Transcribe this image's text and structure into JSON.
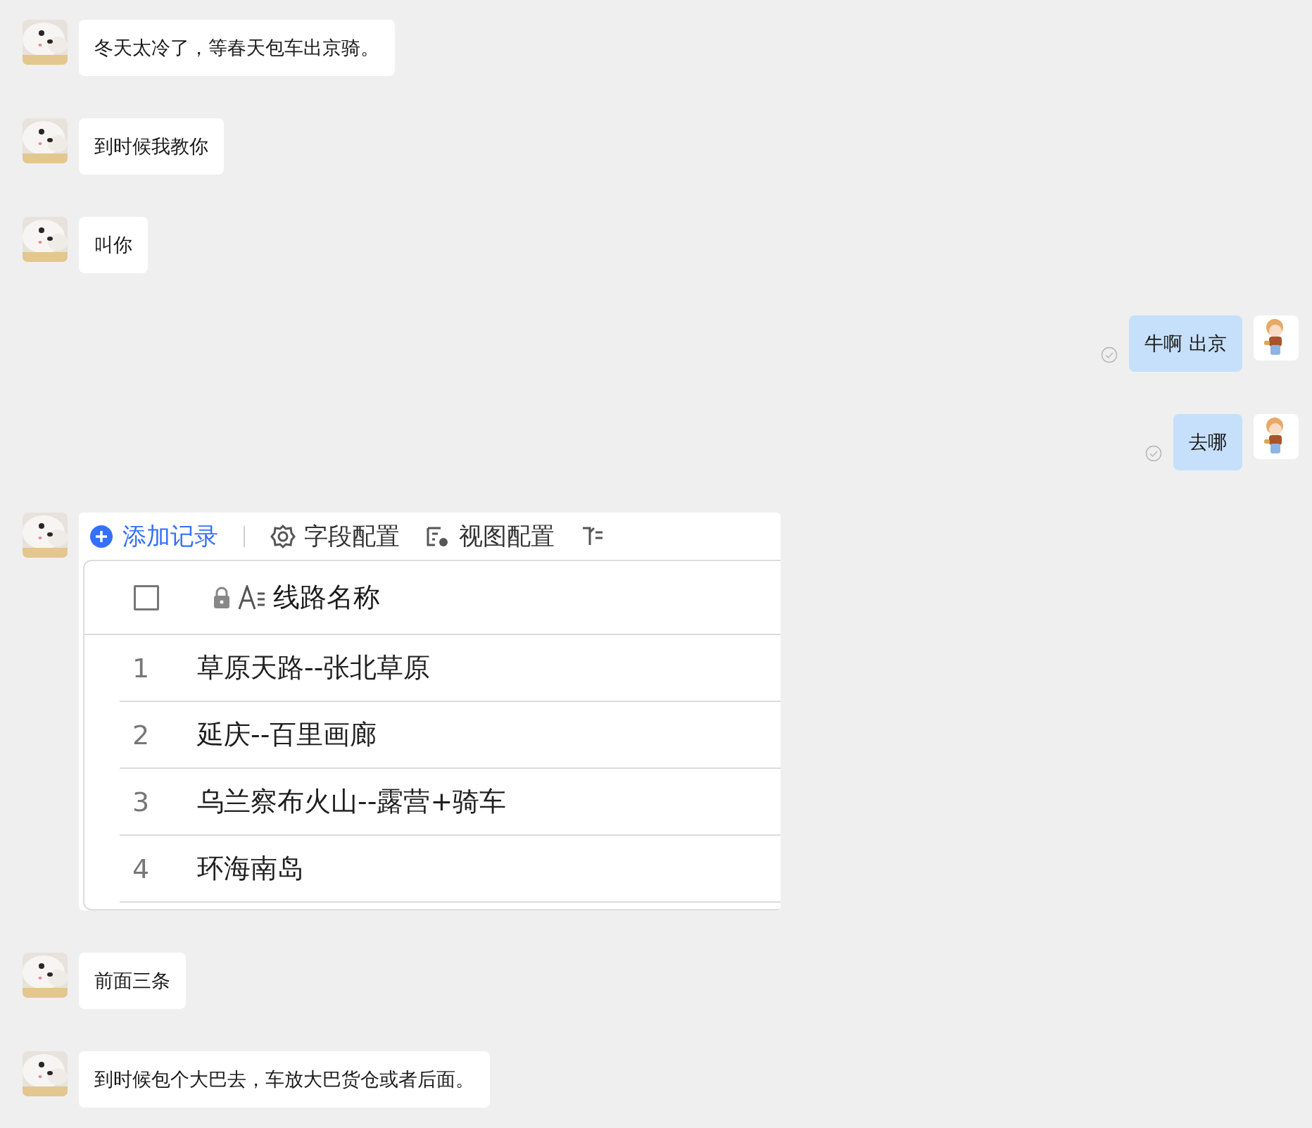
{
  "messages": [
    {
      "outgoing": false,
      "kind": "text",
      "text": "冬天太冷了，等春天包车出京骑。"
    },
    {
      "outgoing": false,
      "kind": "text",
      "text": "到时候我教你"
    },
    {
      "outgoing": false,
      "kind": "text",
      "text": "叫你"
    },
    {
      "outgoing": true,
      "kind": "text",
      "text": "牛啊 出京",
      "delivered": true
    },
    {
      "outgoing": true,
      "kind": "text",
      "text": "去哪",
      "delivered": true
    },
    {
      "outgoing": false,
      "kind": "table_image",
      "toolbar": [
        "添加记录",
        "字段配置",
        "视图配置"
      ],
      "header": {
        "checked": false,
        "column": "线路名称"
      },
      "rows": [
        {
          "index": "1",
          "name": "草原天路--张北草原"
        },
        {
          "index": "2",
          "name": "延庆--百里画廊"
        },
        {
          "index": "3",
          "name": "乌兰察布火山--露营+骑车"
        },
        {
          "index": "4",
          "name": "环海南岛"
        }
      ]
    },
    {
      "outgoing": false,
      "kind": "text",
      "text": "前面三条"
    },
    {
      "outgoing": false,
      "kind": "text",
      "text": "到时候包个大巴去，车放大巴货仓或者后面。"
    }
  ]
}
